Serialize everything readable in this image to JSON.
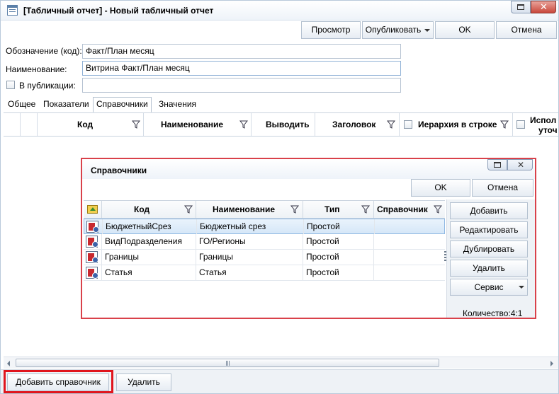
{
  "window": {
    "title": "[Табличный отчет] - Новый табличный отчет"
  },
  "toolbar": {
    "preview": "Просмотр",
    "publish": "Опубликовать",
    "ok": "OK",
    "cancel": "Отмена"
  },
  "form": {
    "code_label": "Обозначение (код):",
    "code_value": "Факт/План месяц",
    "name_label": "Наименование:",
    "name_value": "Витрина Факт/План месяц",
    "publication_label": "В публикации:",
    "publication_value": ""
  },
  "tabs": [
    {
      "label": "Общее"
    },
    {
      "label": "Показатели"
    },
    {
      "label": "Справочники"
    },
    {
      "label": "Значения"
    }
  ],
  "main_grid": {
    "columns": [
      "Код",
      "Наименование",
      "Выводить",
      "Заголовок",
      "Иерархия в строке",
      "Испол",
      "уточ"
    ]
  },
  "dialog": {
    "title": "Справочники",
    "ok": "OK",
    "cancel": "Отмена",
    "columns": [
      "Код",
      "Наименование",
      "Тип",
      "Справочник"
    ],
    "rows": [
      {
        "code": "БюджетныйСрез",
        "name": "Бюджетный срез",
        "type": "Простой",
        "ref": ""
      },
      {
        "code": "ВидПодразделения",
        "name": "ГО/Регионы",
        "type": "Простой",
        "ref": ""
      },
      {
        "code": "Границы",
        "name": "Границы",
        "type": "Простой",
        "ref": ""
      },
      {
        "code": "Статья",
        "name": "Статья",
        "type": "Простой",
        "ref": ""
      }
    ],
    "actions": {
      "add": "Добавить",
      "edit": "Редактировать",
      "duplicate": "Дублировать",
      "delete": "Удалить",
      "service": "Сервис"
    },
    "count_text": "Количество:4:1"
  },
  "bottom": {
    "add_ref": "Добавить справочник",
    "delete": "Удалить"
  },
  "colors": {
    "highlight": "#e0151d",
    "dialog_border": "#d9414a",
    "selection": "#d6e7f8"
  }
}
